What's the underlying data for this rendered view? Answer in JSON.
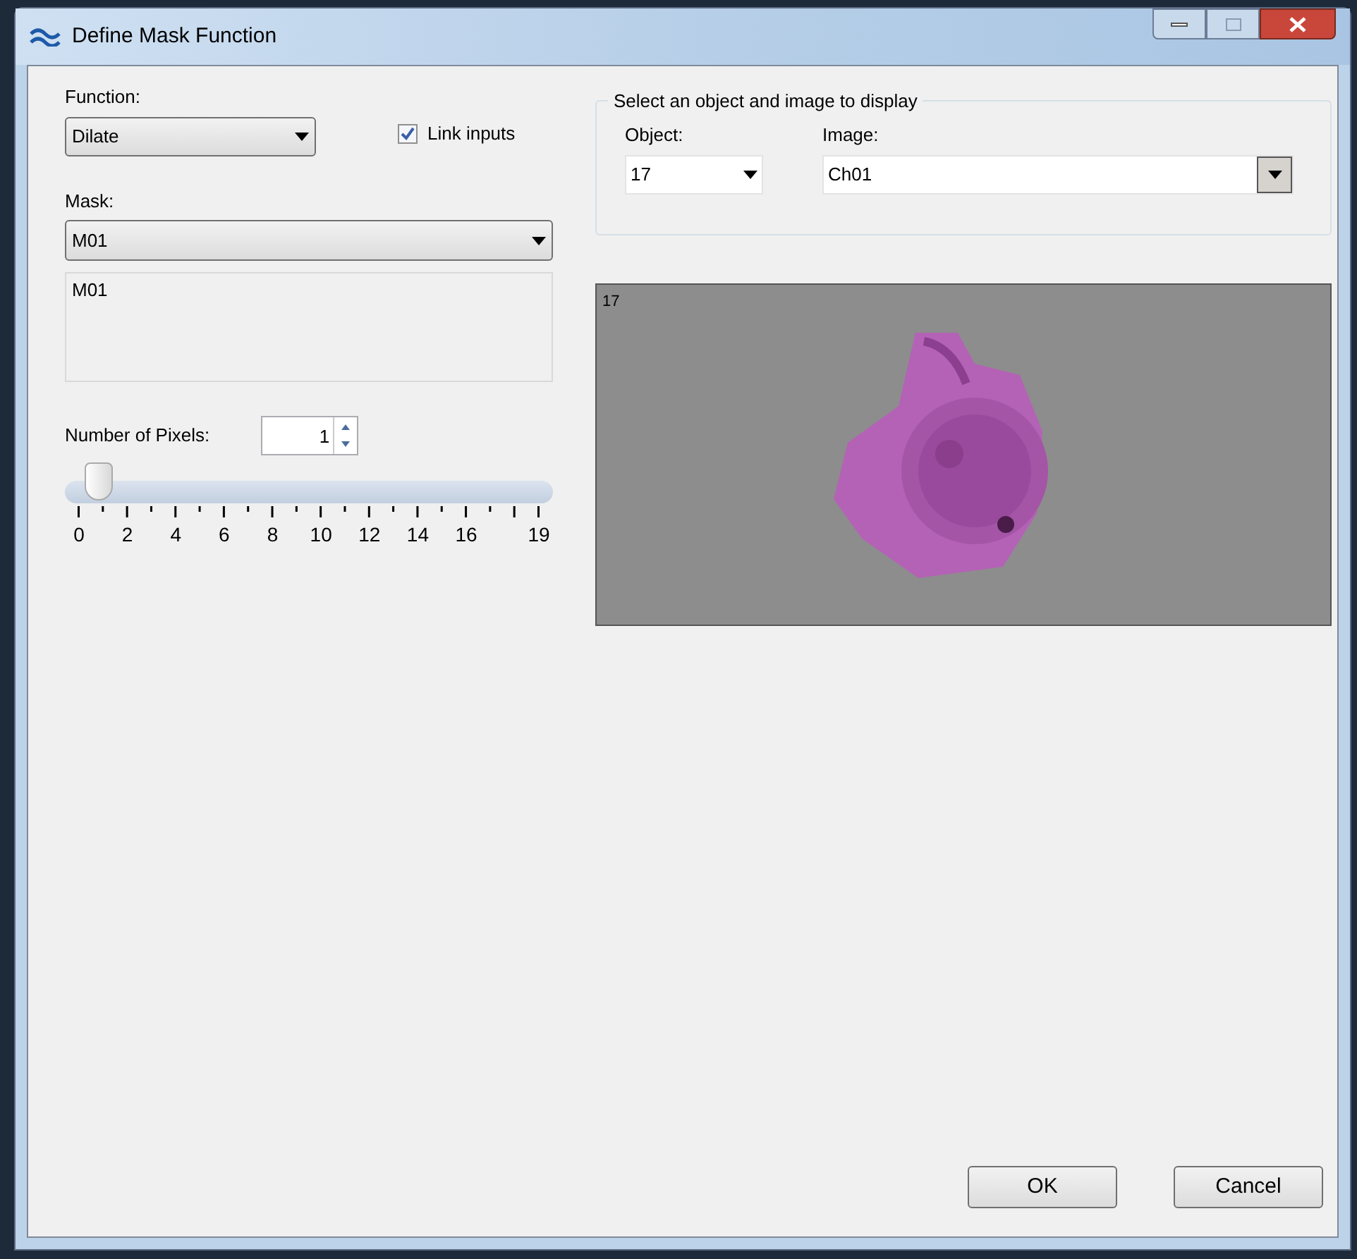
{
  "window": {
    "title": "Define Mask Function"
  },
  "function": {
    "label": "Function:",
    "value": "Dilate"
  },
  "link_inputs": {
    "label": "Link inputs",
    "checked": true
  },
  "mask": {
    "label": "Mask:",
    "value": "M01",
    "expression": "M01"
  },
  "pixels": {
    "label": "Number of Pixels:",
    "value": "1",
    "level": 0.053,
    "tick_labels": [
      "0",
      "2",
      "4",
      "6",
      "8",
      "10",
      "12",
      "14",
      "16",
      "19"
    ]
  },
  "display_group": {
    "title": "Select an object and image to display",
    "object_label": "Object:",
    "object_value": "17",
    "image_label": "Image:",
    "image_value": "Ch01"
  },
  "preview": {
    "caption": "17"
  },
  "buttons": [
    "OK",
    "Cancel"
  ]
}
